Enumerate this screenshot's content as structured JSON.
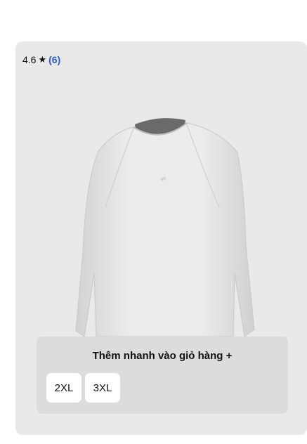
{
  "product": {
    "rating": "4.6",
    "rating_icon": "star-icon",
    "review_count": "(6)",
    "image_subject": "long-sleeve shirt"
  },
  "quick_add": {
    "title": "Thêm nhanh vào giỏ hàng +",
    "sizes": [
      "2XL",
      "3XL"
    ]
  },
  "colors": {
    "card_bg": "#e9e9e9",
    "panel_bg": "#dcdcdc",
    "review_count": "#2f5acf"
  }
}
